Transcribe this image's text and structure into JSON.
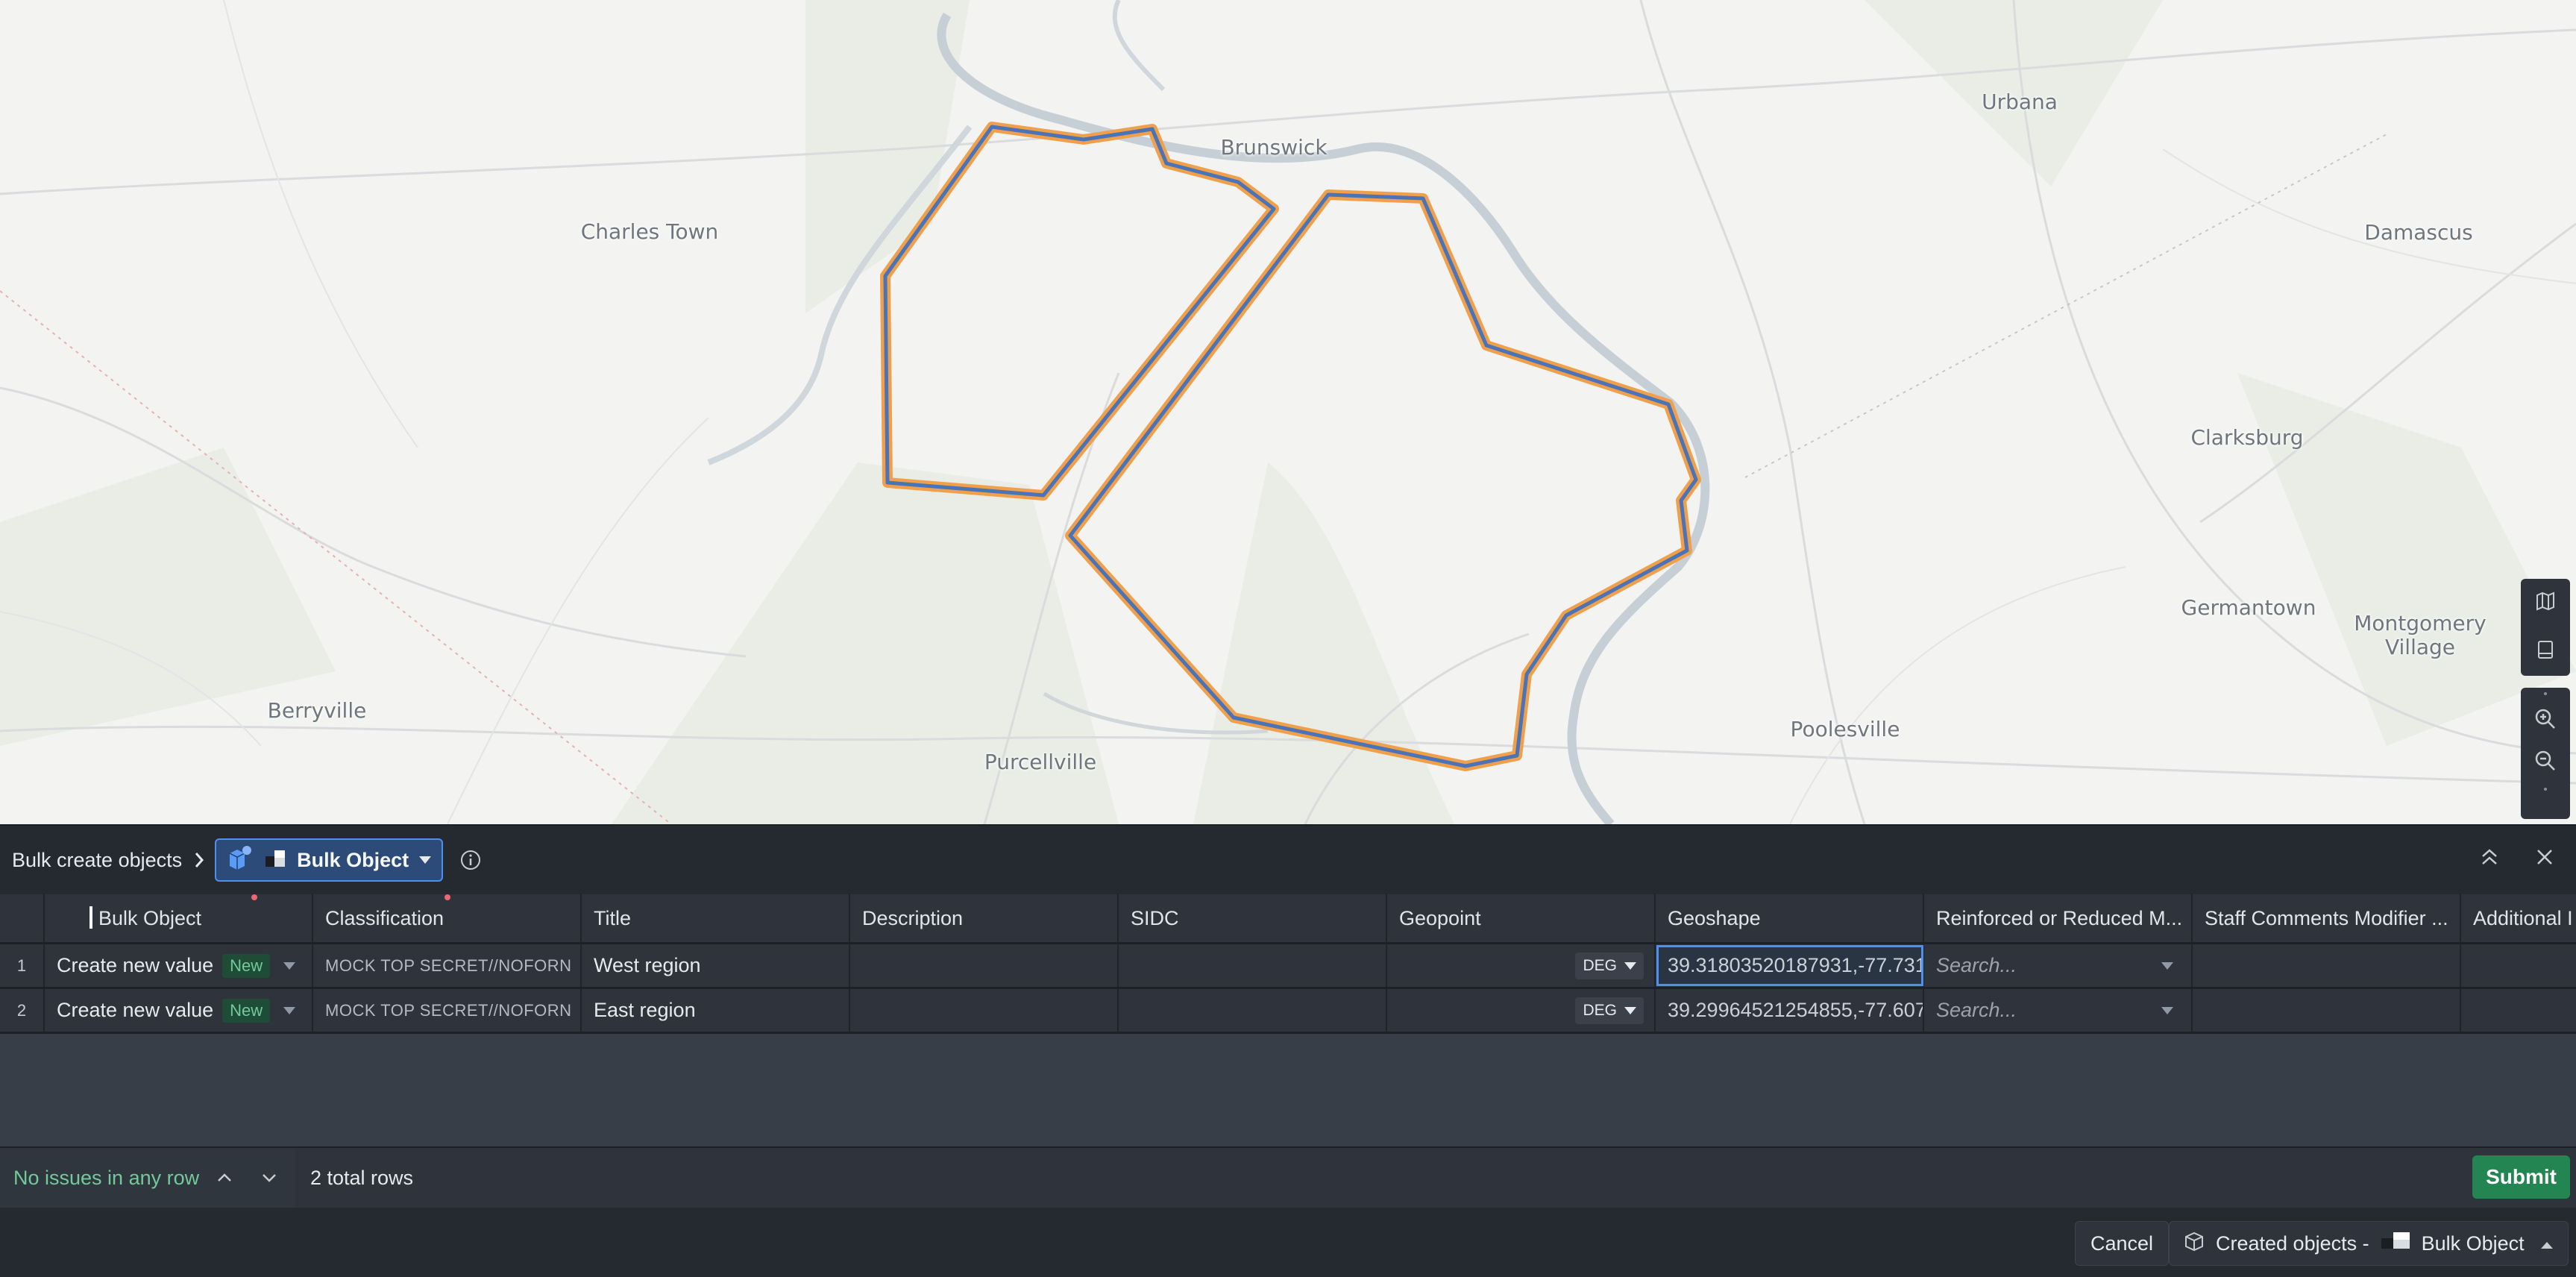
{
  "map": {
    "places": [
      {
        "name": "Brunswick",
        "class": "town"
      },
      {
        "name": "Urbana",
        "class": "town"
      },
      {
        "name": "Charles Town",
        "class": "town"
      },
      {
        "name": "Damascus",
        "class": "town"
      },
      {
        "name": "Clarksburg",
        "class": "town"
      },
      {
        "name": "Germantown",
        "class": "town"
      },
      {
        "name": "Montgomery\nVillage",
        "class": "town"
      },
      {
        "name": "Berryville",
        "class": "town"
      },
      {
        "name": "Purcellville",
        "class": "town"
      },
      {
        "name": "Poolesville",
        "class": "town"
      }
    ],
    "colors": {
      "polygon_fill": "#3a7bd5",
      "polygon_stroke": "#f0a04b",
      "polygon_inner": "#4a73b8"
    }
  },
  "header": {
    "breadcrumb": "Bulk create objects",
    "object_type": "Bulk Object"
  },
  "grid": {
    "columns": [
      {
        "label": "Bulk Object",
        "required": true
      },
      {
        "label": "Classification",
        "required": true
      },
      {
        "label": "Title",
        "required": false
      },
      {
        "label": "Description",
        "required": false
      },
      {
        "label": "SIDC",
        "required": false
      },
      {
        "label": "Geopoint",
        "required": false
      },
      {
        "label": "Geoshape",
        "required": false
      },
      {
        "label": "Reinforced or Reduced M...",
        "required": false
      },
      {
        "label": "Staff Comments Modifier ...",
        "required": false
      },
      {
        "label": "Additional I",
        "required": false
      }
    ],
    "rows": [
      {
        "num": "1",
        "bulk_object": "Create new value",
        "badge": "New",
        "classification": "MOCK TOP SECRET//NOFORN",
        "title": "West region",
        "description": "",
        "sidc": "",
        "geopoint_unit": "DEG",
        "geoshape": "39.31803520187931,-77.731",
        "reinforced_placeholder": "Search...",
        "staff_comments": "",
        "additional": ""
      },
      {
        "num": "2",
        "bulk_object": "Create new value",
        "badge": "New",
        "classification": "MOCK TOP SECRET//NOFORN",
        "title": "East region",
        "description": "",
        "sidc": "",
        "geopoint_unit": "DEG",
        "geoshape": "39.29964521254855,-77.607",
        "reinforced_placeholder": "Search...",
        "staff_comments": "",
        "additional": ""
      }
    ]
  },
  "status": {
    "issues": "No issues in any row",
    "total_rows": "2 total rows",
    "submit_label": "Submit"
  },
  "footer": {
    "cancel_label": "Cancel",
    "created_prefix": "Created objects -",
    "created_type": "Bulk Object"
  }
}
